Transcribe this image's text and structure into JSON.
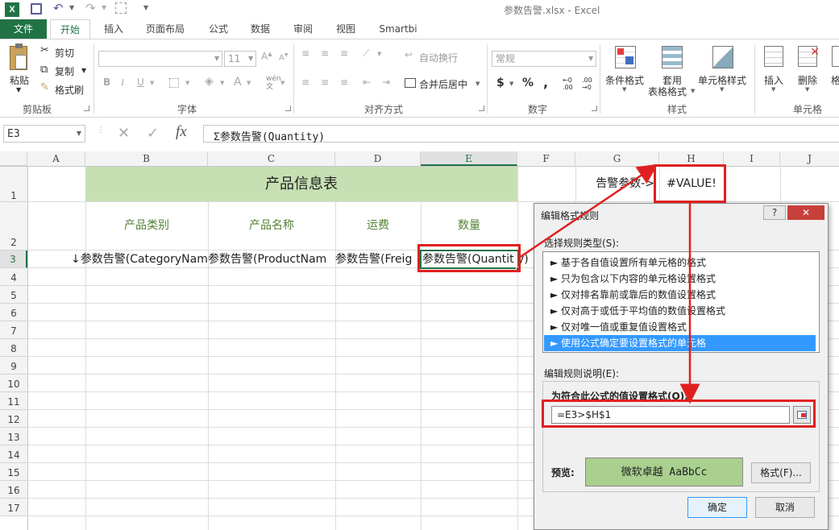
{
  "window": {
    "title": "参数告警.xlsx - Excel"
  },
  "ribbon_tabs": [
    "文件",
    "开始",
    "插入",
    "页面布局",
    "公式",
    "数据",
    "审阅",
    "视图",
    "Smartbi"
  ],
  "ribbon": {
    "paste": "粘贴",
    "cut": "剪切",
    "copy": "复制",
    "format_painter": "格式刷",
    "clipboard_label": "剪贴板",
    "font_size": "11",
    "font_label": "字体",
    "wrap_text": "自动换行",
    "merge_center": "合并后居中",
    "align_label": "对齐方式",
    "number_format": "常规",
    "number_label": "数字",
    "cond_format": "条件格式",
    "table_format_1": "套用",
    "table_format_2": "表格格式",
    "cell_styles": "单元格样式",
    "styles_label": "样式",
    "insert": "插入",
    "delete": "删除",
    "cells_label": "单元格",
    "format_partial": "格"
  },
  "formula_bar": {
    "name_box": "E3",
    "formula": "Σ参数告警(Quantity)"
  },
  "columns": [
    "A",
    "B",
    "C",
    "D",
    "E",
    "F",
    "G",
    "H",
    "I",
    "J"
  ],
  "rows": [
    "1",
    "2",
    "3",
    "4",
    "5",
    "6",
    "7",
    "8",
    "9",
    "10",
    "11",
    "12",
    "13",
    "14",
    "15",
    "16",
    "17"
  ],
  "cells": {
    "title": "产品信息表",
    "header_category": "产品类别",
    "header_name": "产品名称",
    "header_freight": "运费",
    "header_quantity": "数量",
    "b3": "↓参数告警(CategoryNam",
    "c3": "参数告警(ProductNam",
    "d3": "参数告警(Freig",
    "e3": "参数告警(Quantit",
    "e3_overflow": "y)",
    "g1": "告警参数->",
    "h1": "#VALUE!"
  },
  "dialog": {
    "title": "编辑格式规则",
    "help": "?",
    "close": "✕",
    "rule_type_label": "选择规则类型(S):",
    "rule_types": [
      "► 基于各自值设置所有单元格的格式",
      "► 只为包含以下内容的单元格设置格式",
      "► 仅对排名靠前或靠后的数值设置格式",
      "► 仅对高于或低于平均值的数值设置格式",
      "► 仅对唯一值或重复值设置格式",
      "► 使用公式确定要设置格式的单元格"
    ],
    "selected_index": 5,
    "edit_desc_label": "编辑规则说明(E):",
    "formula_label": "为符合此公式的值设置格式(O):",
    "formula": "=E3>$H$1",
    "preview_label": "预览:",
    "preview_text": "微软卓越  AaBbCc",
    "format_button": "格式(F)...",
    "ok": "确定",
    "cancel": "取消"
  },
  "colors": {
    "excel_green": "#217346",
    "header_fill": "#c6e0b4",
    "header_text": "#548235",
    "selection": "#3399ff",
    "annotation": "#e02020",
    "preview_fill": "#a9d08e"
  }
}
